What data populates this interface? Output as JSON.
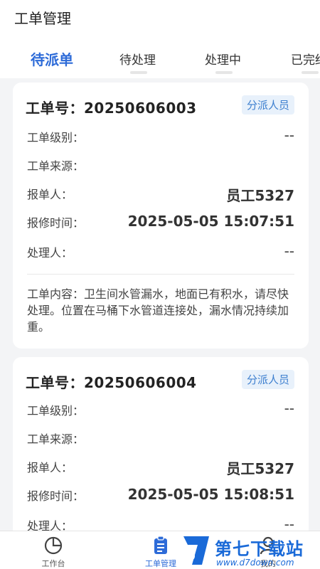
{
  "header": {
    "title": "工单管理"
  },
  "tabs": [
    {
      "label": "待派单",
      "active": true
    },
    {
      "label": "待处理",
      "active": false
    },
    {
      "label": "处理中",
      "active": false
    },
    {
      "label": "已完结",
      "active": false
    }
  ],
  "orders": [
    {
      "number_label": "工单号：",
      "number": "20250606003",
      "badge": "分派人员",
      "level_label": "工单级别：",
      "level_value": "--",
      "source_label": "工单来源：",
      "reporter_label": "报单人：",
      "reporter_value": "员工5327",
      "time_label": "报修时间：",
      "time_value": "2025-05-05 15:07:51",
      "handler_label": "处理人：",
      "handler_value": "--",
      "content": "工单内容：卫生间水管漏水，地面已有积水，请尽快处理。位置在马桶下水管道连接处，漏水情况持续加重。"
    },
    {
      "number_label": "工单号：",
      "number": "20250606004",
      "badge": "分派人员",
      "level_label": "工单级别：",
      "level_value": "--",
      "source_label": "工单来源：",
      "reporter_label": "报单人：",
      "reporter_value": "员工5327",
      "time_label": "报修时间：",
      "time_value": "2025-05-05 15:08:51",
      "handler_label": "处理人：",
      "handler_value": "--"
    }
  ],
  "bottom_nav": [
    {
      "label": "工作台",
      "icon": "pie-chart-icon",
      "active": false
    },
    {
      "label": "工单管理",
      "icon": "clipboard-icon",
      "active": true
    },
    {
      "label": "我的",
      "icon": "user-icon",
      "active": false
    }
  ],
  "watermark": {
    "title": "第七下载站",
    "url": "www.d7down.com"
  },
  "colors": {
    "accent": "#2d6bd8",
    "badge_bg": "#e8f1fb",
    "badge_text": "#3d7fcf"
  }
}
